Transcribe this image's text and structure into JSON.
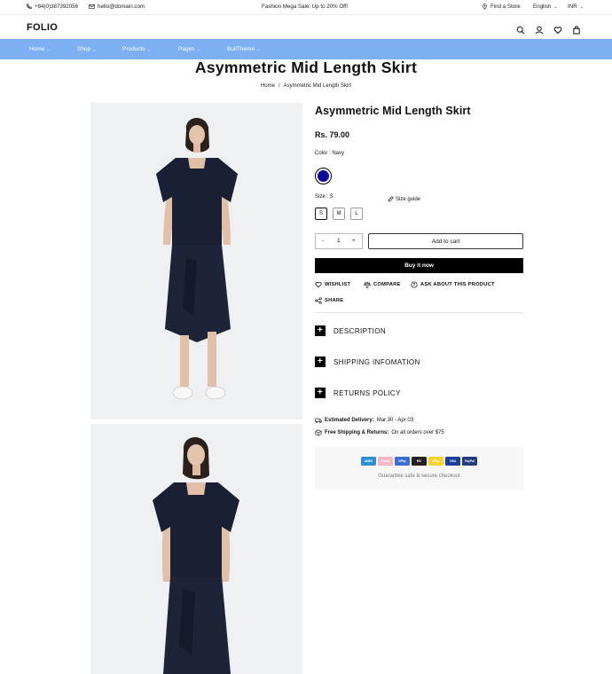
{
  "topbar": {
    "phone": "+84(0)387392056",
    "email": "hello@domain.com",
    "promo": "Fashion Mega Sale: Up to 20% Off!",
    "store": "Find a Store",
    "language": "English",
    "currency": "INR"
  },
  "header": {
    "logo": "FOLIO"
  },
  "nav": [
    {
      "label": "Home"
    },
    {
      "label": "Shop"
    },
    {
      "label": "Products"
    },
    {
      "label": "Pages"
    },
    {
      "label": "BuilTheme"
    }
  ],
  "page_title": "Asymmetric Mid Length Skirt",
  "breadcrumb": {
    "home": "Home",
    "sep": "/",
    "current": "Asymmetric Mid Length Skirt"
  },
  "product": {
    "title": "Asymmetric Mid Length Skirt",
    "price": "Rs. 79.00",
    "color_label": "Color : Navy",
    "swatch_color": "#0b0b9b",
    "size_label": "Size : S",
    "size_guide": "Size guide",
    "sizes": [
      "S",
      "M",
      "L"
    ],
    "selected_size": "S",
    "qty_minus": "-",
    "qty": "1",
    "qty_plus": "+",
    "add_to_cart": "Add to cart",
    "buy_now": "Buy it now"
  },
  "actions": {
    "wishlist": "WISHLIST",
    "compare": "COMPARE",
    "ask": "ASK ABOUT THIS PRODUCT",
    "share": "SHARE"
  },
  "accordions": {
    "description": "DESCRIPTION",
    "shipping": "SHIPPING INFOMATION",
    "returns": "RETURNS POLICY"
  },
  "delivery": {
    "label": "Estimated Delivery:",
    "value": "Mar 30 - Apr 03",
    "shipping_label": "Free Shipping & Returns:",
    "shipping_value": "On all orders over $75"
  },
  "payment": {
    "cards": [
      {
        "name": "AMEX",
        "color": "#2e8fd4"
      },
      {
        "name": "Klarna",
        "color": "#f3b6c6"
      },
      {
        "name": "GPay",
        "color": "#3c6fd6"
      },
      {
        "name": "MC",
        "color": "#222222"
      },
      {
        "name": "GPay",
        "color": "#f6d32b"
      },
      {
        "name": "VISA",
        "color": "#1a3e9c"
      },
      {
        "name": "PayPal",
        "color": "#253b80"
      }
    ],
    "secure_text": "Guarantee safe & secure checkout"
  }
}
